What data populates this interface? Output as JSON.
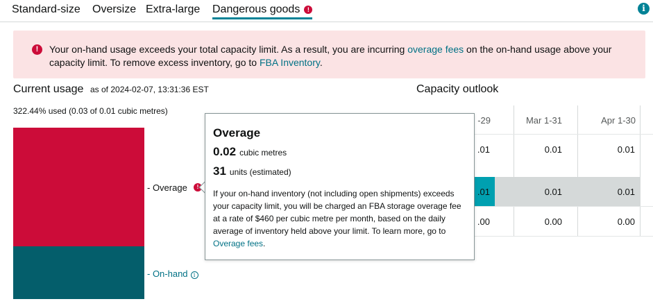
{
  "tabs": [
    {
      "label": "Standard-size",
      "active": false
    },
    {
      "label": "Oversize",
      "active": false
    },
    {
      "label": "Extra-large",
      "active": false
    },
    {
      "label": "Dangerous goods",
      "active": true,
      "alert": true
    }
  ],
  "alert": {
    "text_before": "Your on-hand usage exceeds your total capacity limit. As a result, you are incurring ",
    "link1": "overage fees",
    "text_middle": " on the on-hand usage above your capacity limit. To remove excess inventory, go to ",
    "link2": "FBA Inventory",
    "text_after": "."
  },
  "current_usage": {
    "title": "Current usage",
    "as_of": "as of 2024-02-07, 13:31:36 EST",
    "used_text": "322.44% used (0.03 of 0.01 cubic metres)",
    "overage_label": "- Overage",
    "onhand_label": "- On-hand"
  },
  "capacity_outlook": {
    "title": "Capacity outlook",
    "columns": [
      "-29",
      "Mar 1-31",
      "Apr 1-30"
    ],
    "rows": [
      [
        ".01",
        "0.01",
        "0.01"
      ],
      [
        ".01",
        "0.01",
        "0.01"
      ],
      [
        ".00",
        "0.00",
        "0.00"
      ]
    ]
  },
  "popover": {
    "title": "Overage",
    "volume_value": "0.02",
    "volume_unit": "cubic metres",
    "units_value": "31",
    "units_label": "units (estimated)",
    "description": "If your on-hand inventory (not including open shipments) exceeds your capacity limit, you will be charged an FBA storage overage fee at a rate of $460 per cubic metre per month, based on the daily average of inventory held above your limit. To learn more, go to ",
    "link": "Overage fees",
    "description_end": "."
  },
  "colors": {
    "overage": "#cc0c39",
    "onhand": "#045e6b",
    "accent": "#008296",
    "alert_bg": "#fbe3e4"
  }
}
